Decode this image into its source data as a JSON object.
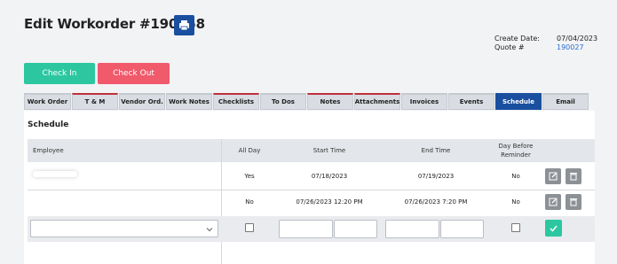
{
  "header": {
    "title": "Edit Workorder #190058"
  },
  "meta": {
    "create_date_label": "Create Date:",
    "create_date_value": "07/04/2023",
    "quote_label": "Quote #",
    "quote_value": "190027"
  },
  "actions": {
    "check_in": "Check In",
    "check_out": "Check Out"
  },
  "tabs": [
    {
      "label": "Work Order"
    },
    {
      "label": "T & M"
    },
    {
      "label": "Vendor Ord."
    },
    {
      "label": "Work Notes"
    },
    {
      "label": "Checklists"
    },
    {
      "label": "To Dos"
    },
    {
      "label": "Notes"
    },
    {
      "label": "Attachments"
    },
    {
      "label": "Invoices"
    },
    {
      "label": "Events"
    },
    {
      "label": "Schedule"
    },
    {
      "label": "Email"
    }
  ],
  "schedule": {
    "title": "Schedule",
    "columns": {
      "employee": "Employee",
      "all_day": "All Day",
      "start_time": "Start Time",
      "end_time": "End Time",
      "reminder_line1": "Day Before",
      "reminder_line2": "Reminder"
    },
    "rows": [
      {
        "employee": "",
        "all_day": "Yes",
        "start": "07/18/2023",
        "end": "07/19/2023",
        "reminder": "No"
      },
      {
        "employee": "",
        "all_day": "No",
        "start": "07/26/2023 12:20 PM",
        "end": "07/26/2023 7:20 PM",
        "reminder": "No"
      }
    ]
  },
  "colors": {
    "primary": "#1a4fa0",
    "success": "#2cc7a0",
    "danger": "#f05a6b",
    "tab_accent": "#c0303a",
    "icon_button": "#8c9196"
  }
}
